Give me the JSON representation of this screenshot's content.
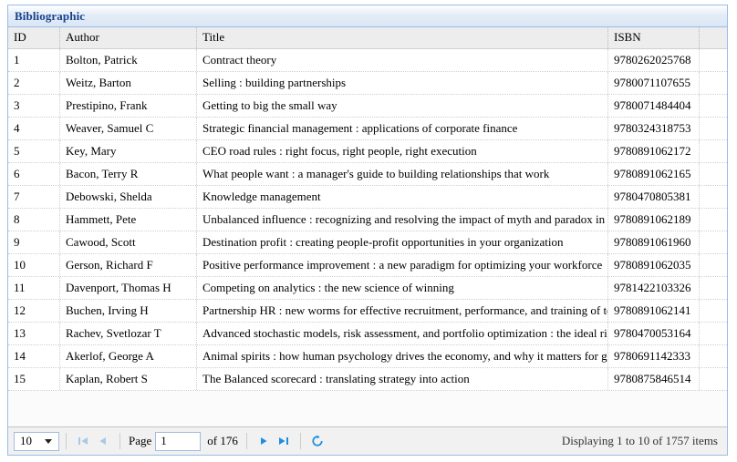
{
  "panel": {
    "title": "Bibliographic",
    "accent_color": "#15428b",
    "border_color": "#99bce8",
    "header_bg": "#dbe6f5"
  },
  "grid": {
    "columns": [
      {
        "key": "id",
        "label": "ID"
      },
      {
        "key": "author",
        "label": "Author"
      },
      {
        "key": "title",
        "label": "Title"
      },
      {
        "key": "isbn",
        "label": "ISBN"
      }
    ],
    "rows": [
      {
        "id": "1",
        "author": "Bolton, Patrick",
        "title": "Contract theory",
        "isbn": "9780262025768"
      },
      {
        "id": "2",
        "author": "Weitz, Barton",
        "title": "Selling : building partnerships",
        "isbn": "9780071107655"
      },
      {
        "id": "3",
        "author": "Prestipino, Frank",
        "title": "Getting to big the small way",
        "isbn": "9780071484404"
      },
      {
        "id": "4",
        "author": "Weaver, Samuel C",
        "title": "Strategic financial management : applications of corporate finance",
        "isbn": "9780324318753"
      },
      {
        "id": "5",
        "author": "Key, Mary",
        "title": "CEO road rules : right focus, right people, right execution",
        "isbn": "9780891062172"
      },
      {
        "id": "6",
        "author": "Bacon, Terry R",
        "title": "What people want : a manager's guide to building relationships that work",
        "isbn": "9780891062165"
      },
      {
        "id": "7",
        "author": "Debowski, Shelda",
        "title": "Knowledge management",
        "isbn": "9780470805381"
      },
      {
        "id": "8",
        "author": "Hammett, Pete",
        "title": "Unbalanced influence : recognizing and resolving the impact of myth and paradox in executive",
        "isbn": "9780891062189"
      },
      {
        "id": "9",
        "author": "Cawood, Scott",
        "title": "Destination profit : creating people-profit opportunities in your organization",
        "isbn": "9780891061960"
      },
      {
        "id": "10",
        "author": "Gerson, Richard F",
        "title": "Positive performance improvement : a new paradigm for optimizing your workforce",
        "isbn": "9780891062035"
      },
      {
        "id": "11",
        "author": "Davenport, Thomas H",
        "title": "Competing on analytics : the new science of winning",
        "isbn": "9781422103326"
      },
      {
        "id": "12",
        "author": "Buchen, Irving H",
        "title": "Partnership HR : new worms for effective recruitment, performance, and training of today's w",
        "isbn": "9780891062141"
      },
      {
        "id": "13",
        "author": "Rachev, Svetlozar T",
        "title": "Advanced stochastic models, risk assessment, and portfolio optimization : the ideal risk, unce",
        "isbn": "9780470053164"
      },
      {
        "id": "14",
        "author": "Akerlof, George A",
        "title": "Animal spirits : how human psychology drives the economy, and why it matters for global ca",
        "isbn": "9780691142333"
      },
      {
        "id": "15",
        "author": "Kaplan, Robert S",
        "title": "The Balanced scorecard : translating strategy into action",
        "isbn": "9780875846514"
      }
    ]
  },
  "toolbar": {
    "page_size": "10",
    "first_label": "first-page",
    "prev_label": "previous-page",
    "page_label": "Page",
    "page_value": "1",
    "of_label": "of 176",
    "next_label": "next-page",
    "last_label": "last-page",
    "refresh_label": "refresh",
    "status": "Displaying 1 to 10 of 1757 items",
    "enabled_color": "#1e8fe0",
    "disabled_color": "#a8c8e4"
  }
}
